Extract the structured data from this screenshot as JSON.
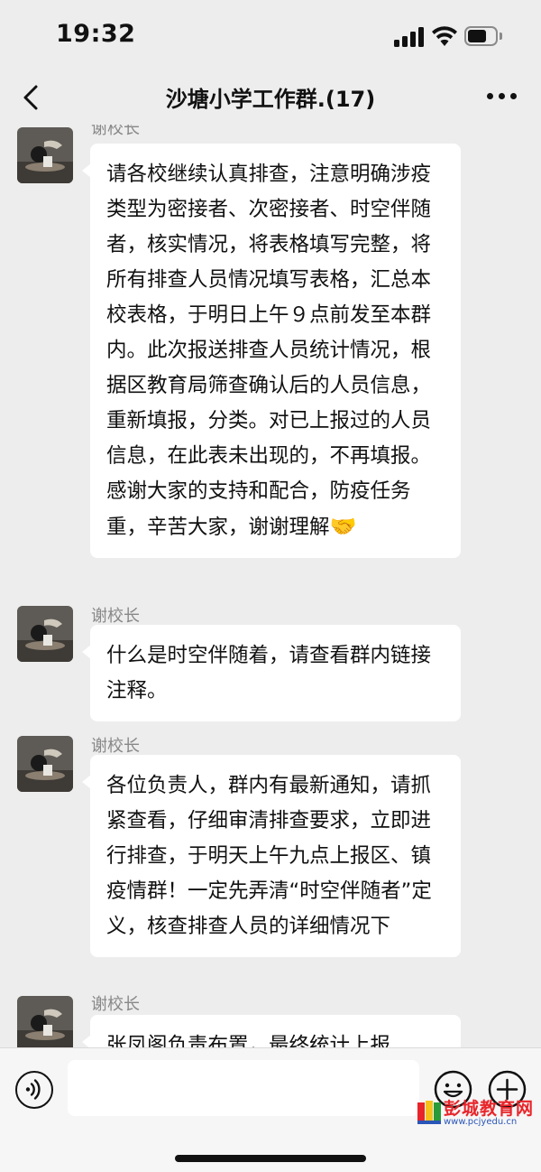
{
  "status_bar": {
    "time": "19:32",
    "battery_level": 0.7
  },
  "header": {
    "title": "沙塘小学工作群.(17)"
  },
  "messages": [
    {
      "sender": "谢校长",
      "text": "请各校继续认真排查，注意明确涉疫类型为密接者、次密接者、时空伴随者，核实情况，将表格填写完整，将所有排查人员情况填写表格，汇总本校表格，于明日上午９点前发至本群内。此次报送排查人员统计情况，根据区教育局筛查确认后的人员信息，重新填报，分类。对已上报过的人员信息，在此表未出现的，不再填报。感谢大家的支持和配合，防疫任务重，辛苦大家，谢谢理解",
      "emoji": "🤝"
    },
    {
      "sender": "谢校长",
      "text": "什么是时空伴随着，请查看群内链接注释。"
    },
    {
      "sender": "谢校长",
      "text": "各位负责人，群内有最新通知，请抓紧查看，仔细审清排查要求，立即进行排查，于明天上午九点上报区、镇疫情群！一定先弄清“时空伴随者”定义，核查排查人员的详细情况下"
    },
    {
      "sender": "谢校长",
      "text": "张凤阁负责布置，最终统计上报"
    }
  ],
  "input_bar": {
    "text_value": ""
  },
  "watermark": {
    "name": "彭城教育网",
    "url": "www.pcjyedu.cn"
  }
}
